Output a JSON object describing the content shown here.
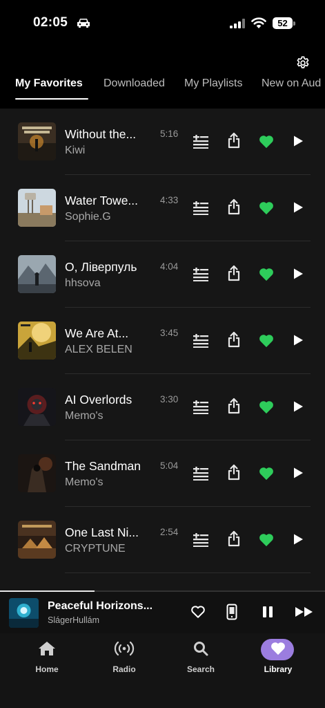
{
  "status_bar": {
    "time": "02:05",
    "battery": "52"
  },
  "tabs": [
    {
      "label": "My Favorites",
      "active": true
    },
    {
      "label": "Downloaded",
      "active": false
    },
    {
      "label": "My Playlists",
      "active": false
    },
    {
      "label": "New on Aud",
      "active": false
    }
  ],
  "tracks": [
    {
      "title": "Without the...",
      "artist": "Kiwi",
      "duration": "5:16",
      "favorited": true
    },
    {
      "title": "Water Towe...",
      "artist": "Sophie.G",
      "duration": "4:33",
      "favorited": true
    },
    {
      "title": "О, Ліверпуль",
      "artist": "hhsova",
      "duration": "4:04",
      "favorited": true
    },
    {
      "title": "We Are At...",
      "artist": "ALEX BELEN",
      "duration": "3:45",
      "favorited": true
    },
    {
      "title": "AI Overlords",
      "artist": "Memo's",
      "duration": "3:30",
      "favorited": true
    },
    {
      "title": "The Sandman",
      "artist": "Memo's",
      "duration": "5:04",
      "favorited": true
    },
    {
      "title": "One Last Ni...",
      "artist": "CRYPTUNE",
      "duration": "2:54",
      "favorited": true
    }
  ],
  "now_playing": {
    "title": "Peaceful Horizons...",
    "artist": "SlágerHullám",
    "progress": 0.29
  },
  "nav": [
    {
      "label": "Home",
      "icon": "home-icon",
      "active": false
    },
    {
      "label": "Radio",
      "icon": "radio-icon",
      "active": false
    },
    {
      "label": "Search",
      "icon": "search-icon",
      "active": false
    },
    {
      "label": "Library",
      "icon": "heart-icon",
      "active": true
    }
  ],
  "colors": {
    "accent": "#9b7ddf",
    "favorite": "#2ecc5b",
    "background": "#000000",
    "list_bg": "#161616"
  }
}
